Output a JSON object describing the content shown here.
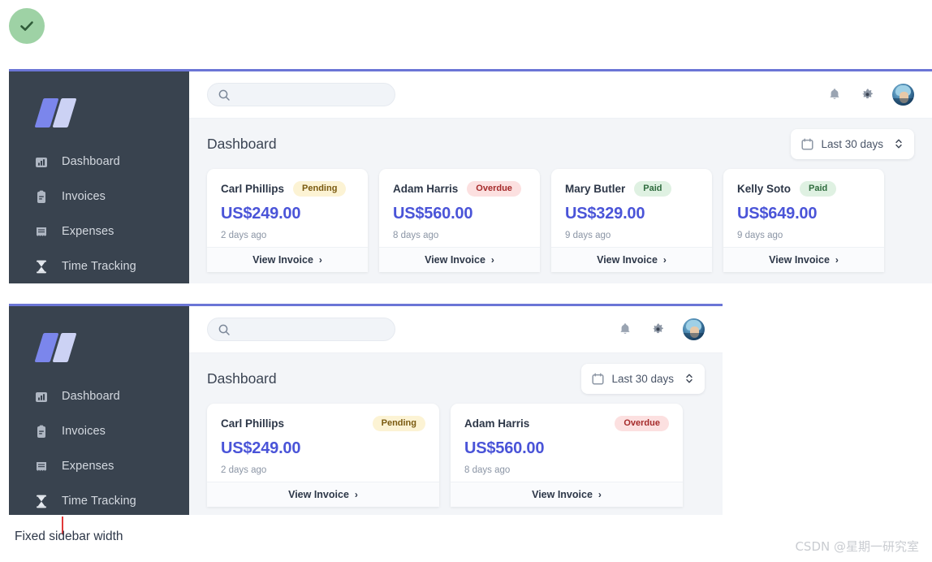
{
  "check_badge": {
    "icon": "check-icon",
    "color": "#9ed2a5"
  },
  "brand": {
    "logo": "logo-mark",
    "colors": [
      "#7b86ec",
      "#ccd2f4"
    ]
  },
  "sidebar": {
    "items": [
      {
        "label": "Dashboard",
        "icon": "bar-chart-icon"
      },
      {
        "label": "Invoices",
        "icon": "clipboard-icon"
      },
      {
        "label": "Expenses",
        "icon": "receipt-icon"
      },
      {
        "label": "Time Tracking",
        "icon": "hourglass-icon"
      }
    ]
  },
  "topbar": {
    "search": {
      "value": "",
      "placeholder": "",
      "icon": "search-icon"
    },
    "notifications_icon": "bell-icon",
    "settings_icon": "gear-icon",
    "avatar": "user-avatar"
  },
  "main": {
    "title": "Dashboard",
    "date_range": {
      "label": "Last 30 days",
      "icon": "calendar-icon",
      "selector_icon": "chevron-updown-icon"
    },
    "view_invoice_label": "View Invoice",
    "view_invoice_arrow": "›"
  },
  "invoices_top": [
    {
      "customer": "Carl Phillips",
      "status": "Pending",
      "status_kind": "pending",
      "amount": "US$249.00",
      "ago": "2 days ago"
    },
    {
      "customer": "Adam Harris",
      "status": "Overdue",
      "status_kind": "overdue",
      "amount": "US$560.00",
      "ago": "8 days ago"
    },
    {
      "customer": "Mary Butler",
      "status": "Paid",
      "status_kind": "paid",
      "amount": "US$329.00",
      "ago": "9 days ago"
    },
    {
      "customer": "Kelly Soto",
      "status": "Paid",
      "status_kind": "paid",
      "amount": "US$649.00",
      "ago": "9 days ago"
    }
  ],
  "invoices_bottom": [
    {
      "customer": "Carl Phillips",
      "status": "Pending",
      "status_kind": "pending",
      "amount": "US$249.00",
      "ago": "2 days ago"
    },
    {
      "customer": "Adam Harris",
      "status": "Overdue",
      "status_kind": "overdue",
      "amount": "US$560.00",
      "ago": "8 days ago"
    }
  ],
  "annotation": {
    "text": "Fixed sidebar width",
    "line_color": "#e03a3a"
  },
  "watermark": {
    "text": "CSDN @星期一研究室"
  },
  "colors": {
    "accent": "#4a54d8",
    "panel_border": "#6b75d6",
    "sidebar_bg": "#39434f",
    "content_bg": "#f3f5f8",
    "pending": "#fcf3d4",
    "overdue": "#fce0e0",
    "paid": "#dff1e2"
  }
}
